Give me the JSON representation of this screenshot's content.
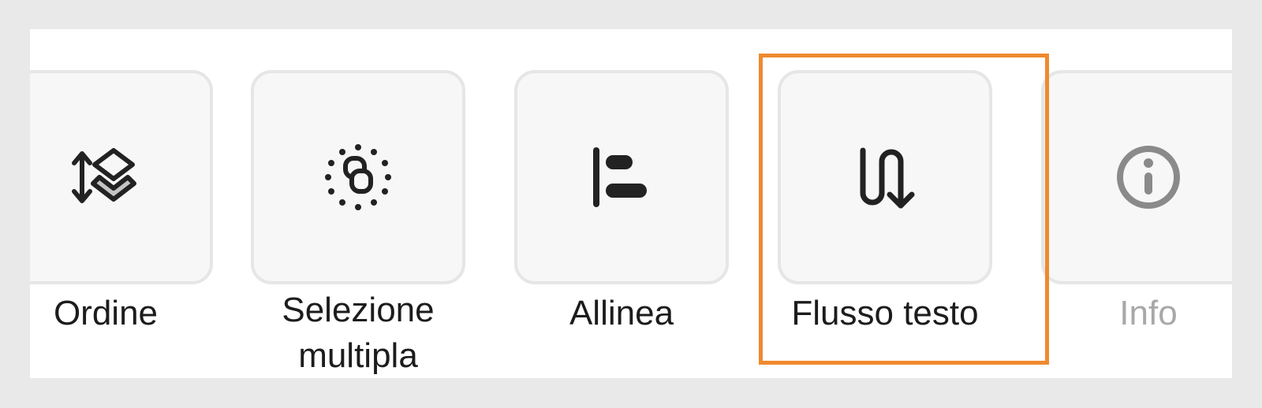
{
  "toolbar": {
    "items": [
      {
        "label": "Ordine",
        "icon": "layer-order-icon",
        "enabled": true
      },
      {
        "label_line1": "Selezione",
        "label_line2": "multipla",
        "icon": "multi-select-icon",
        "enabled": true
      },
      {
        "label": "Allinea",
        "icon": "align-left-icon",
        "enabled": true
      },
      {
        "label": "Flusso testo",
        "icon": "text-flow-icon",
        "enabled": true,
        "highlighted": true
      },
      {
        "label": "Info",
        "icon": "info-icon",
        "enabled": false
      }
    ],
    "highlight_color": "#ef8a2e"
  }
}
